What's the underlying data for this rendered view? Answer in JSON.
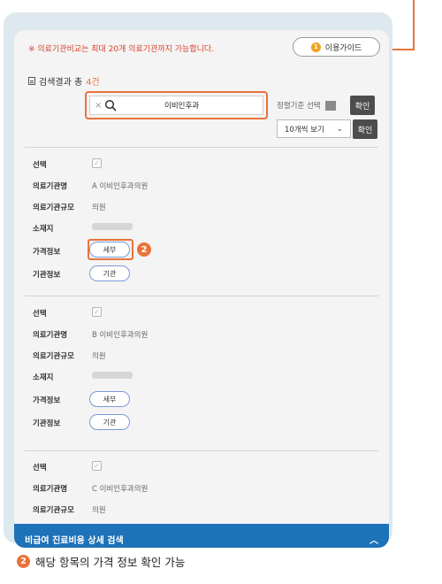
{
  "notice": "※ 의료기관비교는 최대 20개 의료기관까지 가능합니다.",
  "guide_button": {
    "num": "1",
    "label": "이용가이드"
  },
  "result": {
    "prefix": "검색결과 총",
    "count": "4건"
  },
  "search": {
    "value": "이비인후과",
    "clear": "×"
  },
  "sort": {
    "label": "정렬기준 선택"
  },
  "confirm_label": "확인",
  "per_page": {
    "label": "10개씩 보기",
    "chevron": "⌄"
  },
  "fields": {
    "select": "선택",
    "name": "의료기관명",
    "scale": "의료기관규모",
    "location": "소재지",
    "price": "가격정보",
    "inst": "기관정보"
  },
  "records": [
    {
      "letter": "A",
      "name": "이비인후과의원",
      "scale": "의원",
      "price_btn": "세부",
      "inst_btn": "기관"
    },
    {
      "letter": "B",
      "name": "이비인후과의원",
      "scale": "의원",
      "price_btn": "세부",
      "inst_btn": "기관"
    },
    {
      "letter": "C",
      "name": "이비인후과의원",
      "scale": "의원"
    }
  ],
  "badge_num": "2",
  "bottom_bar": {
    "label": "비급여 진료비용 상세 검색",
    "chevron": "︿"
  },
  "caption": "해당 항목의 가격 정보 확인 가능",
  "colors": {
    "accent": "#e8733a",
    "blue": "#1e72b8",
    "notice_red": "#d8422b"
  }
}
